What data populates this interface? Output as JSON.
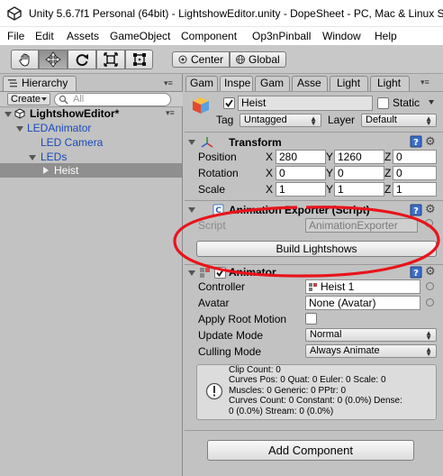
{
  "window": {
    "title": "Unity 5.6.7f1 Personal (64bit) - LightshowEditor.unity - DopeSheet - PC, Mac & Linux Sta"
  },
  "menubar": [
    "File",
    "Edit",
    "Assets",
    "GameObject",
    "Component",
    "Op3nPinball",
    "Window",
    "Help"
  ],
  "toolbar": {
    "tools": [
      "hand-icon",
      "move-icon",
      "rotate-icon",
      "scale-icon",
      "rect-icon"
    ],
    "pivot_label": "Center",
    "space_label": "Global"
  },
  "hierarchy": {
    "tab_label": "Hierarchy",
    "create_label": "Create",
    "search_placeholder": "All",
    "scene_name": "LightshowEditor*",
    "items": [
      {
        "label": "LEDAnimator"
      },
      {
        "label": "LED Camera"
      },
      {
        "label": "LEDs"
      },
      {
        "label": "Heist"
      }
    ]
  },
  "inspector": {
    "tabs": [
      "Gam",
      "Inspe",
      "Gam",
      "Asse",
      "Light",
      "Light"
    ],
    "object_name": "Heist",
    "static_label": "Static",
    "tag_label": "Tag",
    "tag_value": "Untagged",
    "layer_label": "Layer",
    "layer_value": "Default",
    "transform": {
      "title": "Transform",
      "rows": [
        {
          "label": "Position",
          "x": "280",
          "y": "1260",
          "z": "0"
        },
        {
          "label": "Rotation",
          "x": "0",
          "y": "0",
          "z": "0"
        },
        {
          "label": "Scale",
          "x": "1",
          "y": "1",
          "z": "1"
        }
      ],
      "axis_x": "X",
      "axis_y": "Y",
      "axis_z": "Z"
    },
    "exporter": {
      "title": "Animation Exporter (Script)",
      "script_label": "Script",
      "script_value": "AnimationExporter",
      "build_label": "Build Lightshows"
    },
    "animator": {
      "title": "Animator",
      "controller_label": "Controller",
      "controller_value": "Heist 1",
      "avatar_label": "Avatar",
      "avatar_value": "None (Avatar)",
      "root_motion_label": "Apply Root Motion",
      "update_mode_label": "Update Mode",
      "update_mode_value": "Normal",
      "culling_mode_label": "Culling Mode",
      "culling_mode_value": "Always Animate",
      "info_lines": [
        "Clip Count: 0",
        "Curves Pos: 0 Quat: 0 Euler: 0 Scale: 0",
        "Muscles: 0 Generic: 0 PPtr: 0",
        "Curves Count: 0 Constant: 0 (0.0%) Dense:",
        "0 (0.0%) Stream: 0 (0.0%)"
      ]
    },
    "add_component_label": "Add Component"
  },
  "colors": {
    "annotation_red": "#e8141b",
    "unity_blue_text": "#1a4ab8",
    "selection_gray": "#8f8f8f"
  }
}
